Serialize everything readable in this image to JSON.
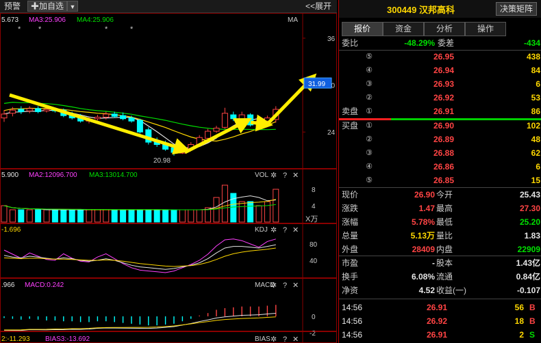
{
  "toolbar": {
    "watch_label": "预警",
    "add_label": "✚加自选",
    "dropdown_label": "▼",
    "expand_label": "<<展开"
  },
  "kline": {
    "ma_values": [
      {
        "label": "5.673",
        "color": "#e6e6e6"
      },
      {
        "label": "MA3:25.906",
        "color": "#ff40ff"
      },
      {
        "label": "MA4:25.906",
        "color": "#00e000"
      }
    ],
    "indicator_name": "MA",
    "price_ticks": [
      "36",
      "30",
      "24"
    ],
    "current_price_tag": "31.99",
    "low_marker": "20.98",
    "asterisks": [
      "*",
      "*",
      "*",
      "*"
    ]
  },
  "volume_pane": {
    "values": [
      {
        "label": "5.900",
        "color": "#e6e6e6"
      },
      {
        "label": "MA2:12096.700",
        "color": "#ff40ff"
      },
      {
        "label": "MA3:13014.700",
        "color": "#00e000"
      }
    ],
    "name": "VOL",
    "ticks": [
      "8",
      "4"
    ],
    "unit": "X万"
  },
  "kdj_pane": {
    "values": [
      {
        "label": "-1.696",
        "color": "#ffd800"
      }
    ],
    "name": "KDJ",
    "ticks": [
      "80",
      "40"
    ]
  },
  "macd_pane": {
    "values": [
      {
        "label": ".966",
        "color": "#e6e6e6"
      },
      {
        "label": "MACD:0.242",
        "color": "#ff40ff"
      }
    ],
    "name": "MACD",
    "ticks": [
      "0",
      "-2"
    ]
  },
  "bias_pane": {
    "values": [
      {
        "label": "2:-11.293",
        "color": "#ffd800"
      },
      {
        "label": "BIAS3:-13.692",
        "color": "#ff40ff"
      }
    ],
    "name": "BIAS"
  },
  "pane_icons": {
    "gear": "✲",
    "help": "?",
    "close": "✕"
  },
  "stock": {
    "code_name": "300449 汉邦高科",
    "decision_button": "决策矩阵"
  },
  "tabs": [
    "报价",
    "资金",
    "分析",
    "操作"
  ],
  "order_ratio": {
    "label1": "委比",
    "value1": "-48.29%",
    "label2": "委差",
    "value2": "-434"
  },
  "sell_orders": [
    {
      "label": "",
      "num": "⑤",
      "price": "26.95",
      "vol": "438"
    },
    {
      "label": "",
      "num": "④",
      "price": "26.94",
      "vol": "84"
    },
    {
      "label": "",
      "num": "③",
      "price": "26.93",
      "vol": "6"
    },
    {
      "label": "",
      "num": "②",
      "price": "26.92",
      "vol": "53"
    },
    {
      "label": "卖盘",
      "num": "①",
      "price": "26.91",
      "vol": "86"
    }
  ],
  "buy_orders": [
    {
      "label": "买盘",
      "num": "①",
      "price": "26.90",
      "vol": "102"
    },
    {
      "label": "",
      "num": "②",
      "price": "26.89",
      "vol": "48"
    },
    {
      "label": "",
      "num": "③",
      "price": "26.88",
      "vol": "62"
    },
    {
      "label": "",
      "num": "④",
      "price": "26.86",
      "vol": "6"
    },
    {
      "label": "",
      "num": "⑤",
      "price": "26.85",
      "vol": "15"
    }
  ],
  "quote": [
    {
      "l1": "现价",
      "v1": "26.90",
      "c1": "#ff4444",
      "l2": "今开",
      "v2": "25.43",
      "c2": "#e6e6e6"
    },
    {
      "l1": "涨跌",
      "v1": "1.47",
      "c1": "#ff4444",
      "l2": "最高",
      "v2": "27.30",
      "c2": "#ff4444"
    },
    {
      "l1": "涨幅",
      "v1": "5.78%",
      "c1": "#ff4444",
      "l2": "最低",
      "v2": "25.20",
      "c2": "#00e000"
    },
    {
      "l1": "总量",
      "v1": "5.13万",
      "c1": "#ffd800",
      "l2": "量比",
      "v2": "1.83",
      "c2": "#e6e6e6"
    },
    {
      "l1": "外盘",
      "v1": "28409",
      "c1": "#ff4444",
      "l2": "内盘",
      "v2": "22909",
      "c2": "#00e000"
    }
  ],
  "fundamentals": [
    {
      "l1": "市盈",
      "v1": "-",
      "l2": "股本",
      "v2": "1.43亿"
    },
    {
      "l1": "换手",
      "v1": "6.08%",
      "l2": "流通",
      "v2": "0.84亿"
    },
    {
      "l1": "净资",
      "v1": "4.52",
      "l2": "收益(一)",
      "v2": "-0.107"
    }
  ],
  "trades": [
    {
      "time": "14:56",
      "price": "26.91",
      "vol": "56",
      "side": "B",
      "side_color": "#ff4444"
    },
    {
      "time": "14:56",
      "price": "26.92",
      "vol": "18",
      "side": "B",
      "side_color": "#ff4444"
    },
    {
      "time": "14:56",
      "price": "26.91",
      "vol": "2",
      "side": "S",
      "side_color": "#00e000"
    }
  ],
  "colors": {
    "up": "#ff4444",
    "down": "#00ffff",
    "arrow": "#ffee00",
    "ma5": "#e6e6e6",
    "ma10": "#ffd800",
    "ma20": "#ff40ff",
    "ma30": "#00e000"
  },
  "chart_data": [
    {
      "type": "candlestick",
      "title": "MA",
      "ylim": [
        20,
        38
      ],
      "yticks": [
        36,
        30,
        24
      ],
      "candles": [
        {
          "o": 25.8,
          "c": 26.3,
          "h": 26.8,
          "l": 25.3
        },
        {
          "o": 26.4,
          "c": 26.8,
          "h": 27.2,
          "l": 26.0
        },
        {
          "o": 26.9,
          "c": 26.6,
          "h": 27.3,
          "l": 26.3
        },
        {
          "o": 26.7,
          "c": 27.0,
          "h": 27.3,
          "l": 26.4
        },
        {
          "o": 27.0,
          "c": 26.6,
          "h": 27.3,
          "l": 26.4
        },
        {
          "o": 26.7,
          "c": 26.9,
          "h": 27.1,
          "l": 26.5
        },
        {
          "o": 26.9,
          "c": 26.7,
          "h": 27.1,
          "l": 26.5
        },
        {
          "o": 26.8,
          "c": 26.1,
          "h": 27.0,
          "l": 25.9
        },
        {
          "o": 26.3,
          "c": 25.8,
          "h": 26.6,
          "l": 25.6
        },
        {
          "o": 26.0,
          "c": 25.4,
          "h": 26.3,
          "l": 25.2
        },
        {
          "o": 25.4,
          "c": 25.6,
          "h": 25.9,
          "l": 25.1
        },
        {
          "o": 25.7,
          "c": 25.9,
          "h": 26.2,
          "l": 25.5
        },
        {
          "o": 25.9,
          "c": 26.3,
          "h": 26.6,
          "l": 25.6
        },
        {
          "o": 26.3,
          "c": 26.0,
          "h": 26.6,
          "l": 25.8
        },
        {
          "o": 26.1,
          "c": 25.7,
          "h": 26.5,
          "l": 25.5
        },
        {
          "o": 25.8,
          "c": 25.4,
          "h": 26.1,
          "l": 25.2
        },
        {
          "o": 25.5,
          "c": 24.0,
          "h": 25.7,
          "l": 23.8
        },
        {
          "o": 24.3,
          "c": 22.7,
          "h": 24.6,
          "l": 22.4
        },
        {
          "o": 22.9,
          "c": 22.4,
          "h": 23.3,
          "l": 22.1
        },
        {
          "o": 22.6,
          "c": 21.8,
          "h": 22.9,
          "l": 21.6
        },
        {
          "o": 22.0,
          "c": 21.4,
          "h": 22.3,
          "l": 20.98
        },
        {
          "o": 21.3,
          "c": 21.8,
          "h": 22.1,
          "l": 21.2
        },
        {
          "o": 21.8,
          "c": 22.4,
          "h": 22.7,
          "l": 21.6
        },
        {
          "o": 22.3,
          "c": 23.3,
          "h": 23.6,
          "l": 22.1
        },
        {
          "o": 23.2,
          "c": 24.1,
          "h": 24.4,
          "l": 23.0
        },
        {
          "o": 24.1,
          "c": 24.5,
          "h": 24.8,
          "l": 23.9
        },
        {
          "o": 24.6,
          "c": 26.4,
          "h": 27.1,
          "l": 24.4
        },
        {
          "o": 26.2,
          "c": 25.7,
          "h": 26.6,
          "l": 25.4
        },
        {
          "o": 25.6,
          "c": 26.2,
          "h": 26.6,
          "l": 25.3
        },
        {
          "o": 26.2,
          "c": 24.9,
          "h": 26.4,
          "l": 24.7
        },
        {
          "o": 24.9,
          "c": 25.4,
          "h": 25.7,
          "l": 24.6
        },
        {
          "o": 25.4,
          "c": 25.8,
          "h": 26.1,
          "l": 25.2
        },
        {
          "o": 25.6,
          "c": 26.9,
          "h": 27.3,
          "l": 25.2
        }
      ]
    },
    {
      "type": "bar",
      "title": "VOL",
      "ylim": [
        0,
        10
      ],
      "values": [
        4,
        3,
        3,
        3,
        3,
        3,
        3,
        3,
        3,
        3,
        3,
        3,
        3,
        3,
        3,
        3,
        3,
        3,
        3,
        3,
        3,
        3,
        3,
        3,
        3.5,
        6,
        9,
        7,
        5,
        5,
        4,
        5,
        8
      ]
    }
  ]
}
